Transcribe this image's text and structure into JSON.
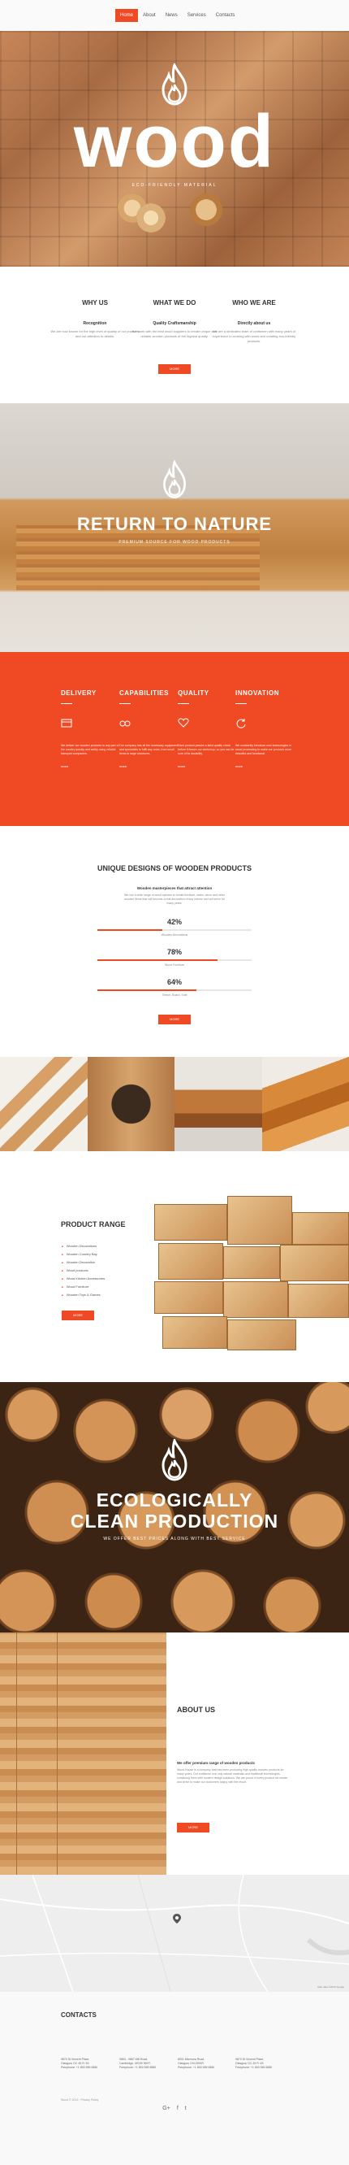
{
  "nav": {
    "items": [
      {
        "label": "Home",
        "active": true
      },
      {
        "label": "About",
        "active": false
      },
      {
        "label": "News",
        "active": false
      },
      {
        "label": "Services",
        "active": false
      },
      {
        "label": "Contacts",
        "active": false
      }
    ],
    "accent": "#f04a24"
  },
  "hero": {
    "title": "wood",
    "tagline": "ECO-FRIENDLY MATERIAL",
    "icon": "flame-icon"
  },
  "why": {
    "columns": [
      {
        "heading": "WHY US",
        "title": "Recognition",
        "text": "We are now known for the high level of quality of our products and our attention to details."
      },
      {
        "heading": "WHAT WE DO",
        "title": "Quality Craftsmanship",
        "text": "We work with the best wood suppliers to create unique and reliable wooden products of the highest quality."
      },
      {
        "heading": "WHO WE ARE",
        "title": "Directly about us",
        "text": "We are a dedicated team of craftsmen with many years of experience in working with wood and creating eco-friendly products."
      }
    ],
    "button": "MORE"
  },
  "nature": {
    "title": "RETURN TO NATURE",
    "subtitle": "PREMIUM SOURCE FOR WOOD PRODUCTS"
  },
  "features": [
    {
      "title": "DELIVERY",
      "icon": "card-icon",
      "text": "We deliver our wooden products to any part of the country quickly and safely using reliable transport companies.",
      "more": "more"
    },
    {
      "title": "CAPABILITIES",
      "icon": "glasses-icon",
      "text": "Our company has all the necessary equipment and specialists to fulfil any order, from small items to large structures.",
      "more": "more"
    },
    {
      "title": "QUALITY",
      "icon": "heart-icon",
      "text": "Each product passes a strict quality check before it leaves our workshop, so you can be sure of its durability.",
      "more": "more"
    },
    {
      "title": "INNOVATION",
      "icon": "refresh-icon",
      "text": "We constantly introduce new technologies in wood processing to make our products more beautiful and functional.",
      "more": "more"
    }
  ],
  "unique": {
    "title": "UNIQUE DESIGNS OF WOODEN PRODUCTS",
    "subtitle": "Wooden masterpieces that attract attention",
    "desc": "We use a wide range of wood species to create furniture, stairs, decor and other wooden items that will become a real decoration of any interior and will serve for many years.",
    "bars": [
      {
        "pct": "42%",
        "value": 0.42,
        "label": "Wooden Decorations"
      },
      {
        "pct": "78%",
        "value": 0.78,
        "label": "Wood Furniture"
      },
      {
        "pct": "64%",
        "value": 0.64,
        "label": "Timber, Board, Sofit"
      }
    ],
    "button": "MORE"
  },
  "product": {
    "title": "PRODUCT RANGE",
    "items": [
      "Wooden Decorations",
      "Wooden Country Bay",
      "Wooden Decoration",
      "Wood products",
      "Wood Kitchen Accessories",
      "Wood Furniture",
      "Wooden Toys & Games"
    ],
    "button": "MORE"
  },
  "eco": {
    "title_line1": "ECOLOGICALLY",
    "title_line2": "CLEAN PRODUCTION",
    "subtitle": "WE OFFER BEST PRICES ALONG WITH BEST SERVICE"
  },
  "about": {
    "title": "ABOUT US",
    "subtitle": "We offer premium range of wooden products",
    "text": "Wood House is a company that has been producing high quality wooden products for many years. Our craftsmen use only natural materials and traditional technologies, combining them with modern design solutions. We are proud of every product we create and strive to make our customers happy with the result.",
    "button": "MORE"
  },
  "map": {
    "credit": "Map data ©2016 Google"
  },
  "contacts": {
    "title": "CONTACTS",
    "offices": [
      {
        "lines": [
          "9870 St Vincent Place,",
          "Glasgow, DC 45 Fr 45.",
          "Freephone: +1 800 559 6580"
        ]
      },
      {
        "lines": [
          "9863 - 9867 Mill Road,",
          "Cambridge, MG09 99HT.",
          "Freephone: +1 800 559 6580"
        ]
      },
      {
        "lines": [
          "8901 Marmora Road,",
          "Glasgow, D04 89GR.",
          "Freephone: +1 800 559 6580"
        ]
      },
      {
        "lines": [
          "9870 St Vincent Place,",
          "Glasgow, DC 45 Fr 45.",
          "Freephone: +1 800 559 6580"
        ]
      }
    ],
    "social": [
      "G+",
      "f",
      "t"
    ],
    "copyright": "Wood © 2016 · Privacy Policy"
  }
}
